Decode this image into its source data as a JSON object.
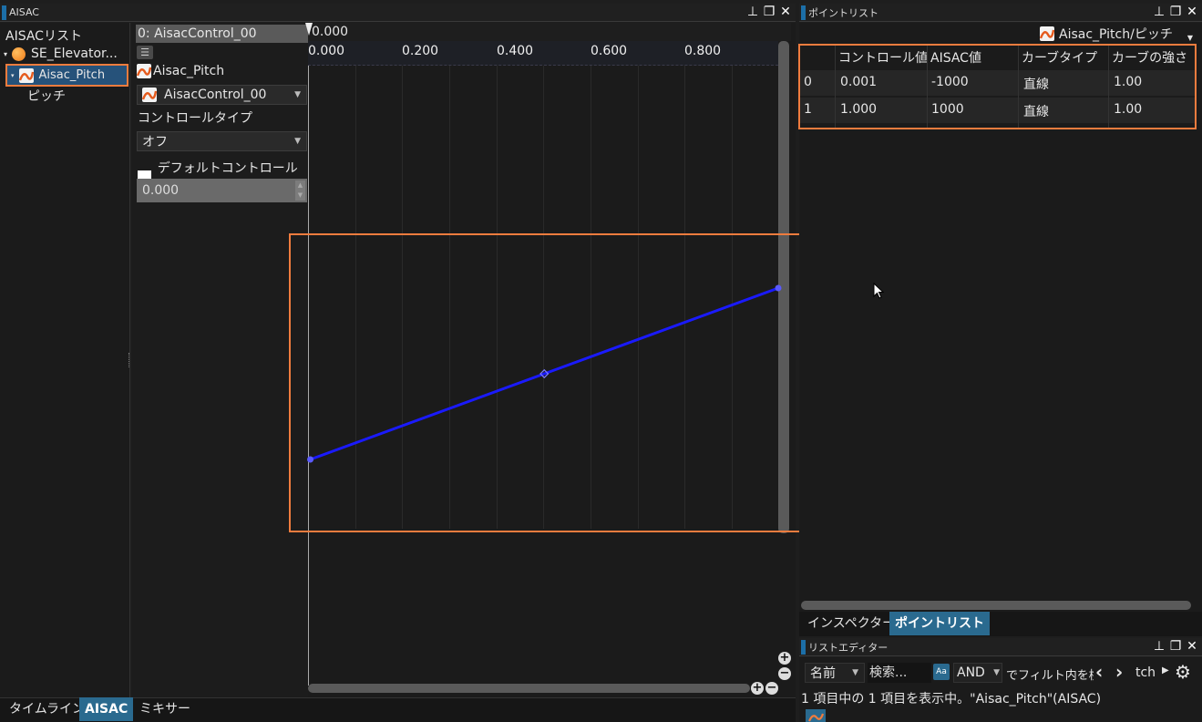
{
  "left_window": {
    "title": "AISAC",
    "tree_header": "AISACリスト",
    "tree_items": [
      "SE_Elevator...",
      "Aisac_Pitch",
      "ピッチ"
    ],
    "control_selector": "0: AisacControl_00",
    "control_value": "0.000",
    "prop_name": "Aisac_Pitch",
    "control_dropdown": "AisacControl_00",
    "control_type_label": "コントロールタイプ",
    "control_type_value": "オフ",
    "default_control_label": "デフォルトコントロール値",
    "default_control_value": "0.000",
    "x_ticks": [
      "0.000",
      "0.200",
      "0.400",
      "0.600",
      "0.800"
    ],
    "bottom_tabs": [
      "タイムライン",
      "AISAC",
      "ミキサー"
    ],
    "zoom_plus": "+",
    "zoom_minus": "−"
  },
  "curve": {
    "points": [
      {
        "control": 0.001,
        "aisac": -1000
      },
      {
        "control": 1.0,
        "aisac": 1000
      }
    ],
    "line_color": "#1a1aff",
    "point_color": "#5a5aff"
  },
  "right_window": {
    "title": "ポイントリスト",
    "target": "Aisac_Pitch/ピッチ",
    "columns": [
      "コントロール値",
      "AISAC値",
      "カーブタイプ",
      "カーブの強さ"
    ],
    "rows": [
      {
        "idx": "0",
        "control": "0.001",
        "aisac": "-1000",
        "type": "直線",
        "strength": "1.00"
      },
      {
        "idx": "1",
        "control": "1.000",
        "aisac": "1000",
        "type": "直線",
        "strength": "1.00"
      }
    ],
    "tabs": [
      "インスペクター",
      "ポイントリスト"
    ]
  },
  "list_editor": {
    "title": "リストエディター",
    "name_dropdown": "名前",
    "search_placeholder": "検索...",
    "case_btn": "Aa",
    "and_dropdown": "AND",
    "filter_text": "でフィルト内を検",
    "nav_text": "tch",
    "status": "1 項目中の 1 項目を表示中。\"Aisac_Pitch\"(AISAC)"
  },
  "colors": {
    "highlight": "#f07c3e",
    "accent_blue": "#1c6fa8",
    "selected_tab": "#2a6a8f"
  }
}
